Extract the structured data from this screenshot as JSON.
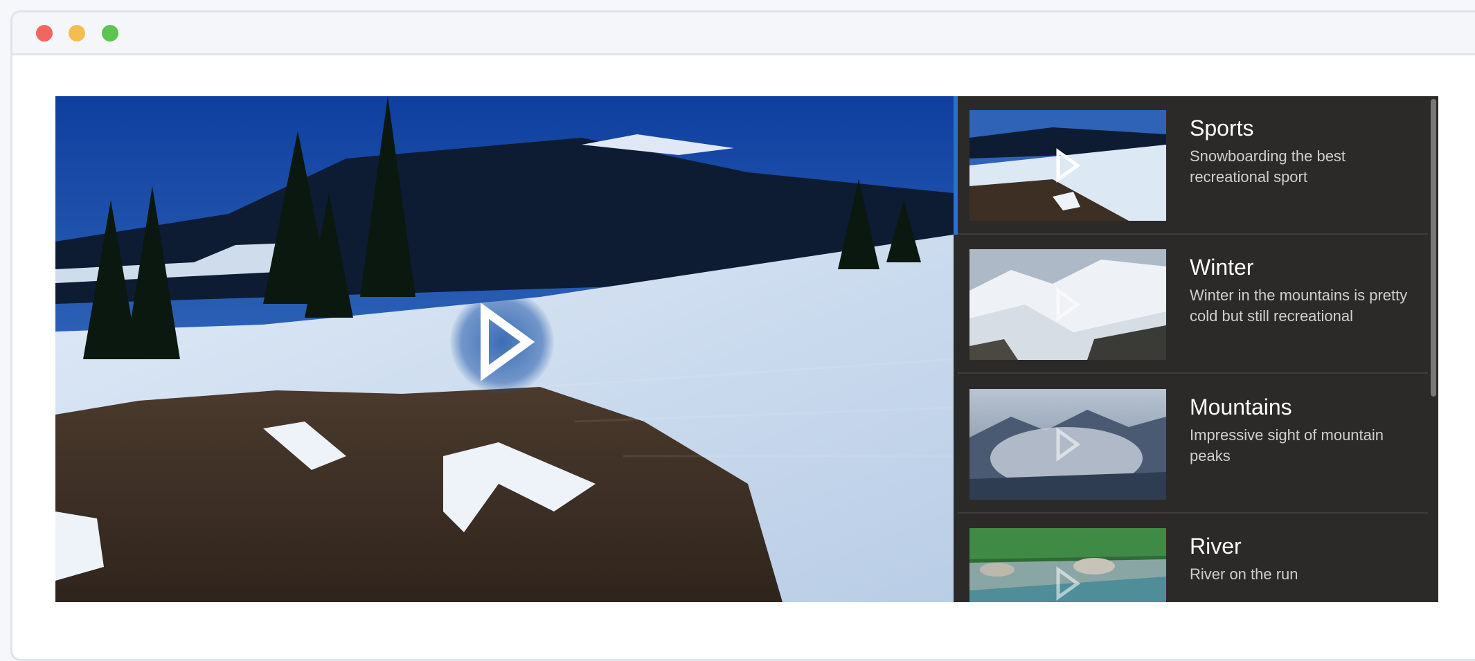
{
  "window": {
    "controls": [
      "close",
      "minimize",
      "maximize"
    ]
  },
  "player": {
    "main_video": {
      "play_icon": "play-icon",
      "accent": "#2d6fd0"
    },
    "playlist": [
      {
        "title": "Sports",
        "description": "Snowboarding the best recreational sport",
        "active": true
      },
      {
        "title": "Winter",
        "description": "Winter in the mountains is pretty cold but still recreational",
        "active": false
      },
      {
        "title": "Mountains",
        "description": "Impressive sight of mountain peaks",
        "active": false
      },
      {
        "title": "River",
        "description": "River on the run",
        "active": false
      }
    ]
  },
  "colors": {
    "playlist_bg": "#2b2a28",
    "accent": "#2d6fd0",
    "close": "#f26560",
    "minimize": "#f4bd50",
    "maximize": "#5ec451"
  }
}
